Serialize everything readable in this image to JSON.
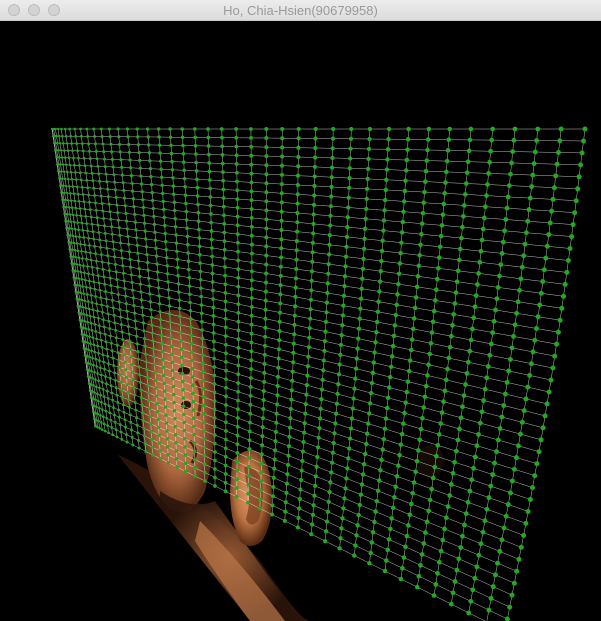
{
  "window": {
    "title": "Ho, Chia-Hsien(90679958)"
  },
  "scene": {
    "background_color": "#000000",
    "mesh_line_color": "#ffffff",
    "control_point_color": "#1faa1f",
    "mesh_columns": 42,
    "mesh_rows": 42,
    "texture": "face-photo"
  }
}
